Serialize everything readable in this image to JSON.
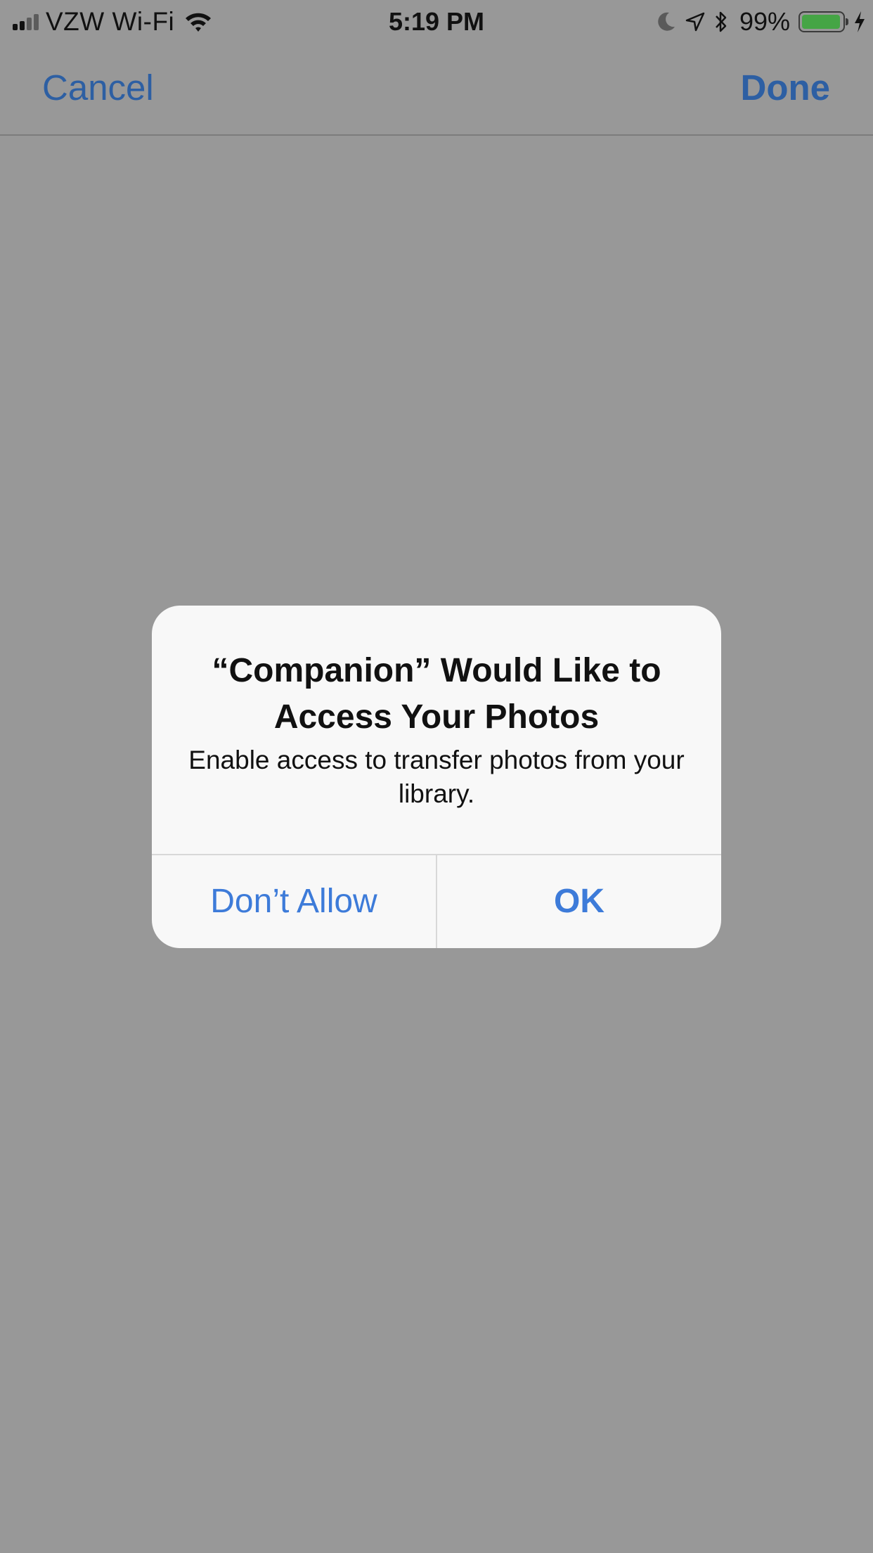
{
  "status_bar": {
    "carrier": "VZW Wi-Fi",
    "time": "5:19 PM",
    "battery_percent": "99%",
    "icons": [
      "signal-icon",
      "wifi-icon",
      "moon-icon",
      "location-icon",
      "bluetooth-icon",
      "battery-icon",
      "charging-icon"
    ]
  },
  "nav": {
    "cancel_label": "Cancel",
    "done_label": "Done",
    "accent_color": "#2d5fa3"
  },
  "alert": {
    "title": "“Companion” Would Like to Access Your Photos",
    "message": "Enable access to transfer photos from your library.",
    "deny_label": "Don’t Allow",
    "ok_label": "OK",
    "button_color": "#3d7bd9"
  },
  "colors": {
    "dimmed_background": "#989898",
    "alert_background": "#f8f8f8",
    "battery_fill": "#45a545"
  }
}
